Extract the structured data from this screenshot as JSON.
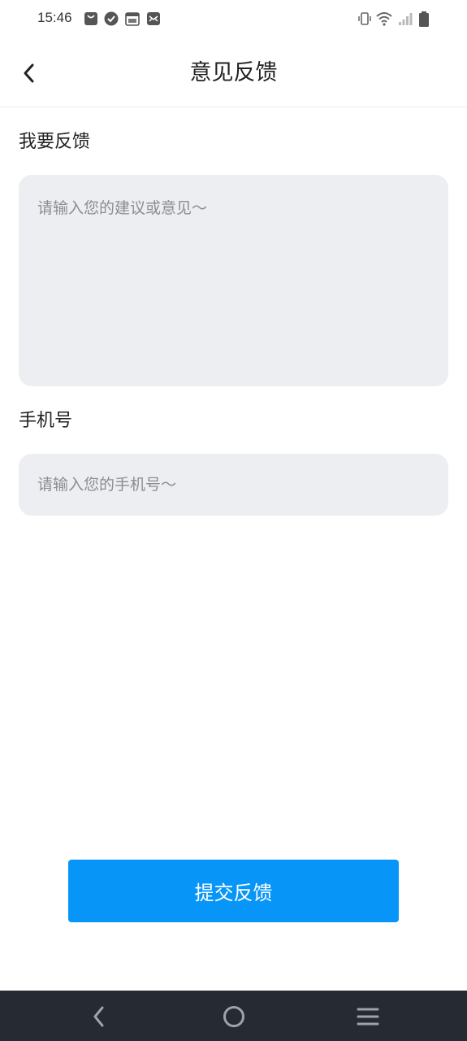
{
  "status_bar": {
    "time": "15:46",
    "left_icons": [
      "bag-icon",
      "check-circle-icon",
      "calendar-icon",
      "mail-icon"
    ],
    "right_icons": [
      "vibrate-icon",
      "wifi-icon",
      "signal-icon",
      "battery-icon"
    ]
  },
  "header": {
    "title": "意见反馈",
    "back_icon": "back-arrow-icon"
  },
  "form": {
    "feedback_label": "我要反馈",
    "feedback_placeholder": "请输入您的建议或意见～",
    "phone_label": "手机号",
    "phone_placeholder": "请输入您的手机号～",
    "submit_label": "提交反馈"
  },
  "nav_bar": {
    "buttons": [
      "nav-back-icon",
      "nav-home-icon",
      "nav-menu-icon"
    ]
  },
  "colors": {
    "accent": "#0796f8",
    "input_bg": "#eceef1",
    "nav_bg": "#252a33"
  }
}
